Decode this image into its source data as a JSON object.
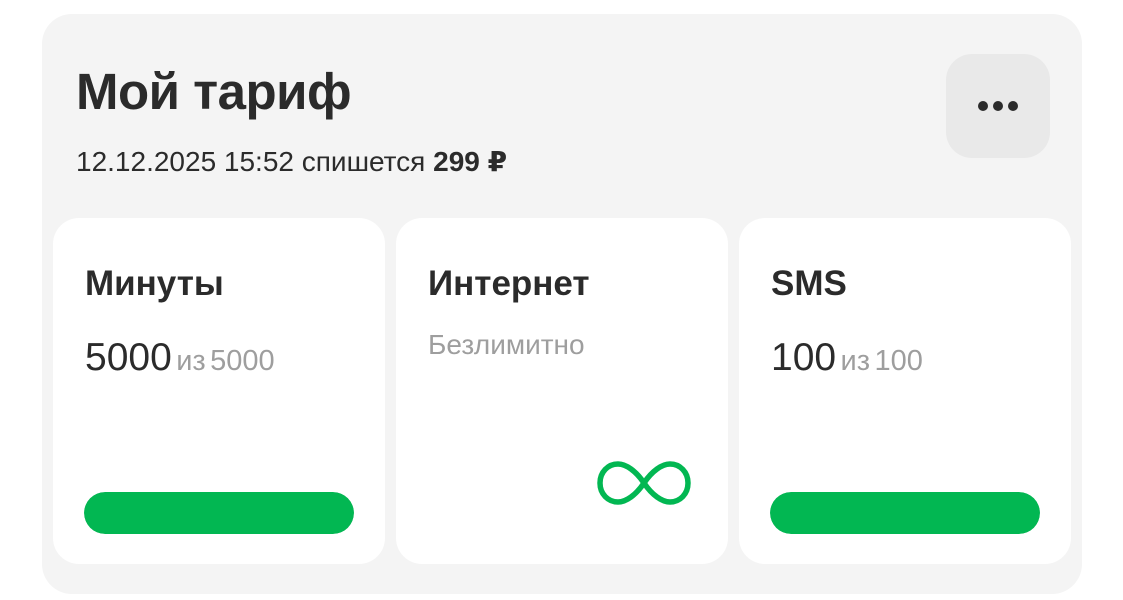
{
  "header": {
    "title": "Мой тариф",
    "next_charge_datetime": "12.12.2025 15:52",
    "next_charge_text": "спишется",
    "next_charge_amount": "299 ₽",
    "more_icon": "ellipsis-icon"
  },
  "tiles": {
    "minutes": {
      "title": "Минуты",
      "remaining": "5000",
      "of_label": "из",
      "total": "5000",
      "progress_fraction": 1.0
    },
    "internet": {
      "title": "Интернет",
      "status": "Безлимитно",
      "icon": "infinity-icon"
    },
    "sms": {
      "title": "SMS",
      "remaining": "100",
      "of_label": "из",
      "total": "100",
      "progress_fraction": 1.0
    }
  },
  "colors": {
    "accent": "#02b752",
    "card_background": "#f4f4f4",
    "tile_background": "#ffffff",
    "primary_text": "#2b2b2b",
    "secondary_text": "#9e9e9e",
    "button_background": "#e9e9e9"
  }
}
